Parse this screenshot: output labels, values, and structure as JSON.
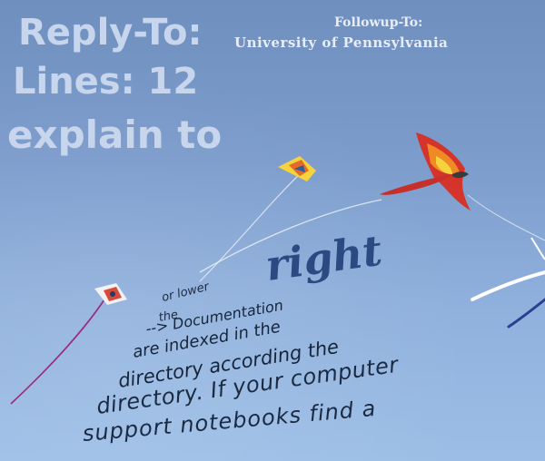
{
  "overlay_text": {
    "reply_to": "Reply-To:",
    "lines": "Lines: 12",
    "explain": "explain to",
    "followup_to": "Followup-To:",
    "university": "University of Pennsylvania",
    "or_lower": "or lower",
    "right": "right",
    "the": "the",
    "documentation": "--> Documentation",
    "indexed": "are indexed in the",
    "directory_according": "directory according the",
    "directory_if": "directory. If your computer",
    "support_notebooks": "support notebooks find a"
  },
  "colors": {
    "sky_top": "#6f8fbf",
    "sky_bottom": "#9cbee6",
    "headline_text": "#c7d6ec",
    "caption_text": "#e7edf7",
    "body_text": "#16253b",
    "accent_text": "#2c4a82",
    "kite_red": "#d4342b",
    "kite_orange": "#f08a24",
    "kite_yellow": "#f4d33c"
  }
}
